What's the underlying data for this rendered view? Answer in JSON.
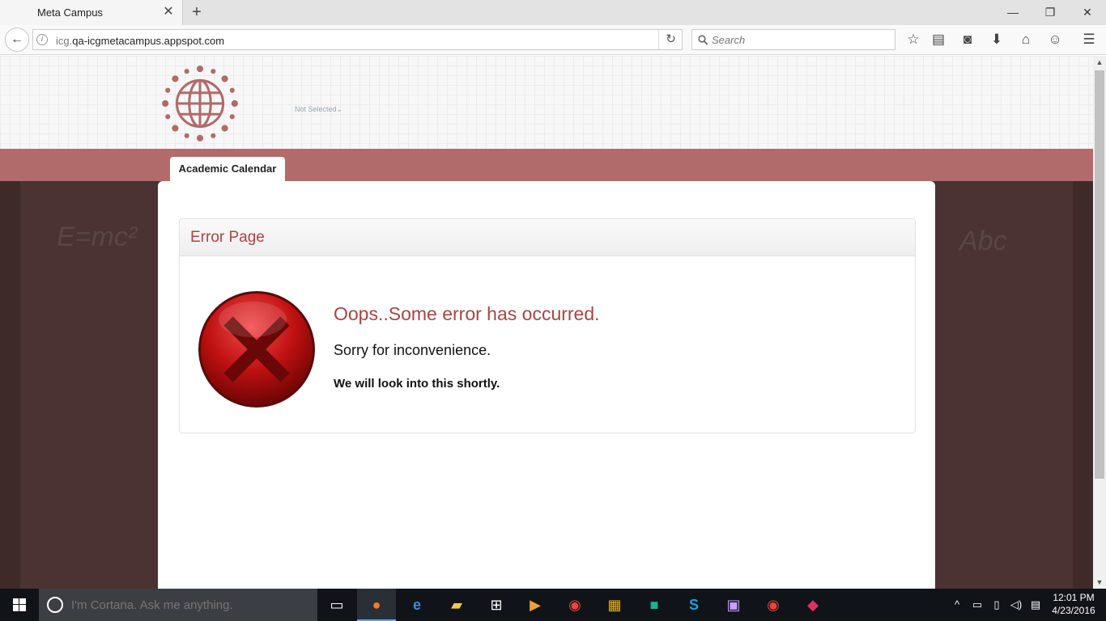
{
  "browser": {
    "tab_title": "Meta Campus",
    "url_prefix": "icg.",
    "url_domain": "qa-icgmetacampus.appspot.com",
    "search_placeholder": "Search"
  },
  "header": {
    "campus_selector": "Not Selected"
  },
  "menu": {
    "tab_label": "Academic Calendar"
  },
  "error_panel": {
    "title": "Error Page",
    "message_heading": "Oops..Some error has occurred.",
    "message_apology": "Sorry for inconvenience.",
    "message_followup": "We will look into this shortly."
  },
  "taskbar": {
    "cortana_placeholder": "I'm Cortana. Ask me anything.",
    "time": "12:01 PM",
    "date": "4/23/2016"
  },
  "colors": {
    "brand": "#b06b6a",
    "error_text": "#a94442",
    "background_dark": "#3f2a2a"
  }
}
